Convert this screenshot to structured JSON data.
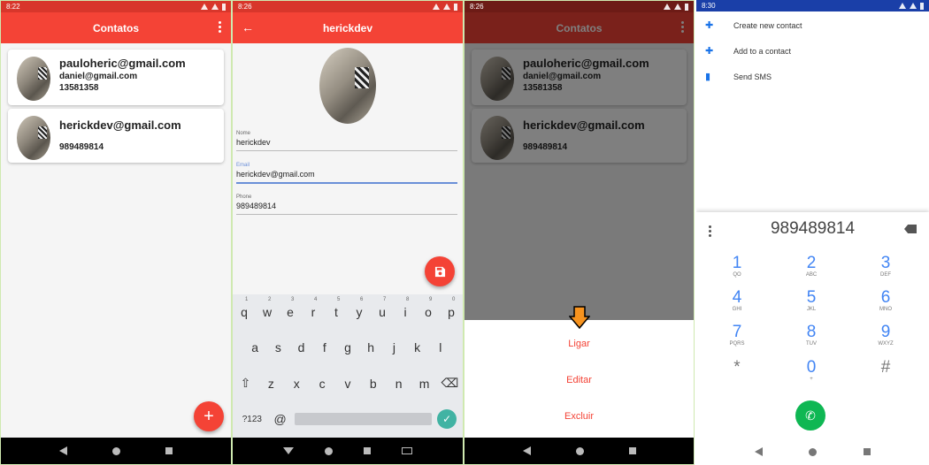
{
  "colors": {
    "accent": "#f44336",
    "dialer_blue": "#4285f4",
    "call_green": "#0fb753",
    "keyboard_check": "#41b3a3"
  },
  "screen1": {
    "status_time": "8:22",
    "title": "Contatos",
    "contacts": [
      {
        "name": "pauloheric@gmail.com",
        "email": "daniel@gmail.com",
        "phone": "13581358"
      },
      {
        "name": "herickdev@gmail.com",
        "phone": "989489814"
      }
    ],
    "fab_icon": "+"
  },
  "screen2": {
    "status_time": "8:26",
    "title": "herickdev",
    "fields": [
      {
        "label": "Nome",
        "value": "herickdev"
      },
      {
        "label": "Email",
        "value": "herickdev@gmail.com"
      },
      {
        "label": "Phone",
        "value": "989489814"
      }
    ],
    "keyboard": {
      "row1": [
        "q",
        "w",
        "e",
        "r",
        "t",
        "y",
        "u",
        "i",
        "o",
        "p"
      ],
      "row1_hints": [
        "1",
        "2",
        "3",
        "4",
        "5",
        "6",
        "7",
        "8",
        "9",
        "0"
      ],
      "row2": [
        "a",
        "s",
        "d",
        "f",
        "g",
        "h",
        "j",
        "k",
        "l"
      ],
      "row3": [
        "z",
        "x",
        "c",
        "v",
        "b",
        "n",
        "m"
      ],
      "symbols": "?123",
      "at": "@"
    }
  },
  "screen3": {
    "status_time": "8:26",
    "title": "Contatos",
    "contacts": [
      {
        "name": "pauloheric@gmail.com",
        "email": "daniel@gmail.com",
        "phone": "13581358"
      },
      {
        "name": "herickdev@gmail.com",
        "phone": "989489814"
      }
    ],
    "actions": [
      "Ligar",
      "Editar",
      "Excluir"
    ]
  },
  "screen4": {
    "status_time": "8:30",
    "menu": [
      {
        "icon": "person-add-icon",
        "label": "Create new contact"
      },
      {
        "icon": "person-add-icon",
        "label": "Add to a contact"
      },
      {
        "icon": "sms-icon",
        "label": "Send SMS"
      }
    ],
    "dialed_number": "989489814",
    "keys": [
      {
        "n": "1",
        "l": "QO"
      },
      {
        "n": "2",
        "l": "ABC"
      },
      {
        "n": "3",
        "l": "DEF"
      },
      {
        "n": "4",
        "l": "GHI"
      },
      {
        "n": "5",
        "l": "JKL"
      },
      {
        "n": "6",
        "l": "MNO"
      },
      {
        "n": "7",
        "l": "PQRS"
      },
      {
        "n": "8",
        "l": "TUV"
      },
      {
        "n": "9",
        "l": "WXYZ"
      },
      {
        "n": "*",
        "l": ""
      },
      {
        "n": "0",
        "l": "+"
      },
      {
        "n": "#",
        "l": ""
      }
    ]
  }
}
